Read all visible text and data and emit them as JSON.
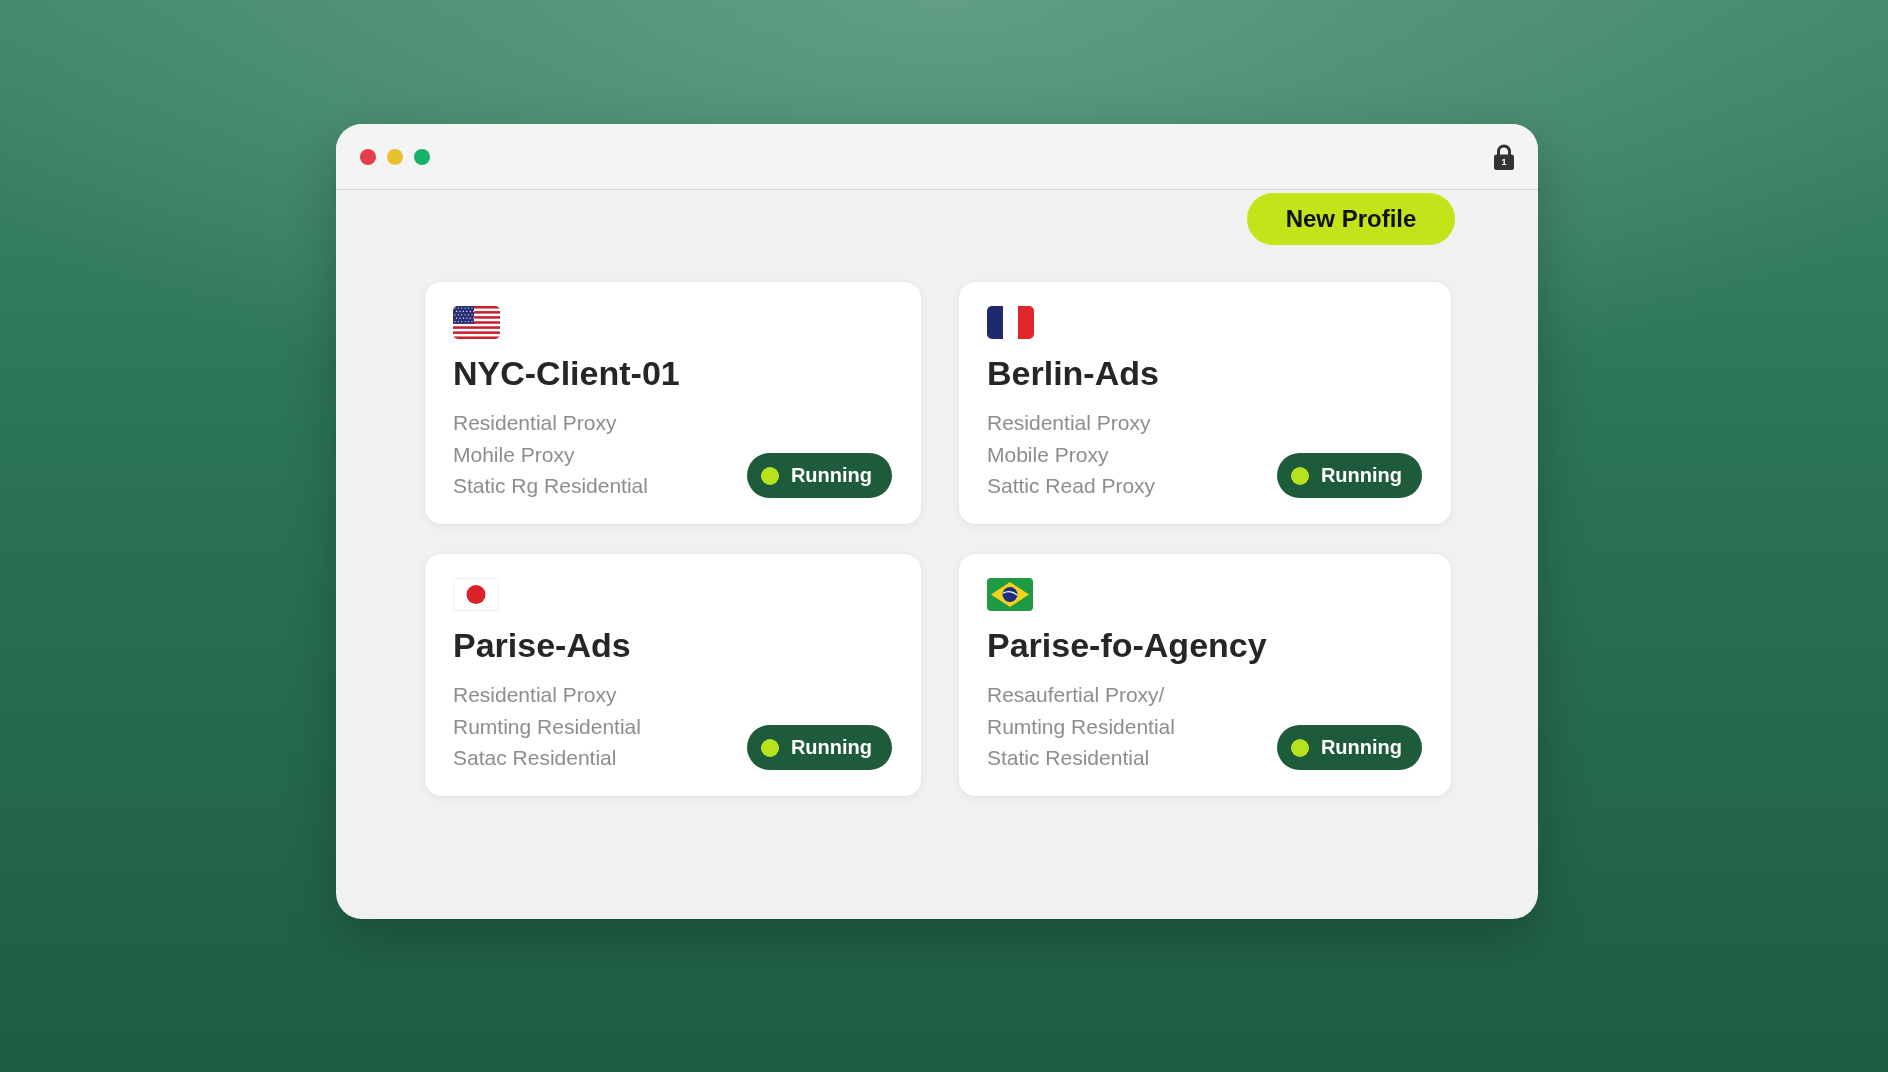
{
  "window": {
    "lock_number": "1"
  },
  "toolbar": {
    "new_profile_button": "New Profile"
  },
  "profiles": [
    {
      "kind": "us",
      "name": "NYC-Client-01",
      "proxies": [
        "Residential Proxy",
        "Mohile Proxy",
        "Static Rg Residential"
      ],
      "status": "Running"
    },
    {
      "kind": "fr",
      "name": "Berlin-Ads",
      "proxies": [
        "Residential Proxy",
        "Mobile Proxy",
        "Sattic Read Proxy"
      ],
      "status": "Running"
    },
    {
      "kind": "jp",
      "name": "Parise-Ads",
      "proxies": [
        "Residential Proxy",
        "Rumting Residential",
        "Satac Residential"
      ],
      "status": "Running"
    },
    {
      "kind": "br",
      "name": "Parise-fo-Agency",
      "proxies": [
        "Resaufertial Proxy/",
        "Rumting Residential",
        "Static Residential"
      ],
      "status": "Running"
    }
  ]
}
